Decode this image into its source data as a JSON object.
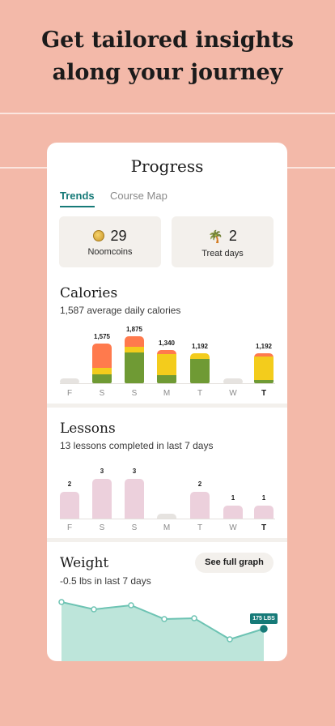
{
  "headline": {
    "line1": "Get tailored insights",
    "line2": "along your journey"
  },
  "card": {
    "title": "Progress",
    "tabs": [
      {
        "label": "Trends",
        "active": true
      },
      {
        "label": "Course Map",
        "active": false
      }
    ]
  },
  "stats": {
    "noomcoins": {
      "value": "29",
      "label": "Noomcoins",
      "icon": "coin-icon"
    },
    "treat_days": {
      "value": "2",
      "label": "Treat days",
      "icon": "palm-tree-icon",
      "glyph": "🌴"
    }
  },
  "calories": {
    "title": "Calories",
    "subtitle": "1,587 average daily calories",
    "days": [
      "F",
      "S",
      "S",
      "M",
      "T",
      "W",
      "T"
    ],
    "bar_labels": [
      "",
      "1,575",
      "1,875",
      "1,340",
      "1,192",
      "",
      "1,192"
    ],
    "colors": {
      "red": "#ff7a4d",
      "yellow": "#f3cc1c",
      "green": "#6f9a34",
      "empty": "#e6e3e0"
    }
  },
  "lessons": {
    "title": "Lessons",
    "subtitle": "13 lessons completed in last 7 days",
    "days": [
      "F",
      "S",
      "S",
      "M",
      "T",
      "W",
      "T"
    ],
    "values": [
      "2",
      "3",
      "3",
      "",
      "2",
      "1",
      "1"
    ],
    "colors": {
      "bar": "#ecd0dc",
      "empty": "#e6e3e0"
    }
  },
  "weight": {
    "title": "Weight",
    "subtitle": "-0.5 lbs in last 7 days",
    "button_label": "See full graph",
    "latest_label": "175 LBS",
    "colors": {
      "line": "#6dc3b3",
      "fill": "#bde5da",
      "point": "#167a78"
    }
  },
  "chart_data": [
    {
      "type": "bar",
      "title": "Calories",
      "categories": [
        "F",
        "S",
        "S",
        "M",
        "T",
        "W",
        "T"
      ],
      "values": [
        0,
        1575,
        1875,
        1340,
        1192,
        0,
        1192
      ],
      "series": [
        {
          "name": "",
          "values": [
            0,
            1575,
            1875,
            1340,
            1192,
            0,
            1192
          ]
        }
      ]
    },
    {
      "type": "bar",
      "title": "Lessons",
      "categories": [
        "F",
        "S",
        "S",
        "M",
        "T",
        "W",
        "T"
      ],
      "values": [
        2,
        3,
        3,
        0,
        2,
        1,
        1
      ]
    },
    {
      "type": "area",
      "title": "Weight",
      "x": [
        1,
        2,
        3,
        4,
        5,
        6,
        7
      ],
      "values": [
        null,
        null,
        null,
        null,
        null,
        null,
        175
      ]
    }
  ]
}
